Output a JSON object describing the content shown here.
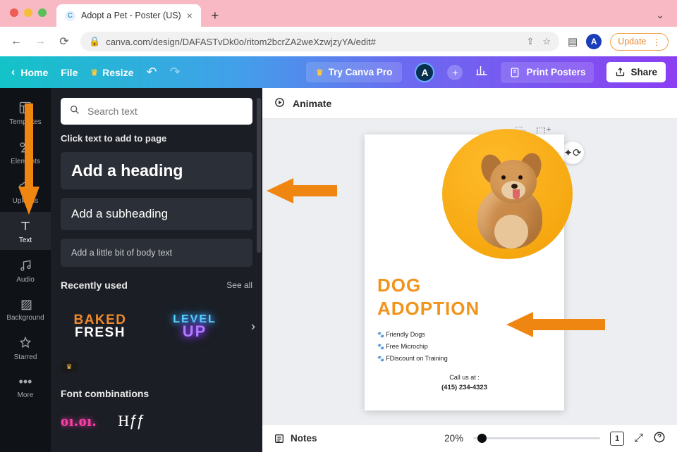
{
  "browser": {
    "tab_title": "Adopt a Pet - Poster (US)",
    "url": "canva.com/design/DAFASTvDk0o/ritom2bcrZA2weXzwjzyYA/edit#",
    "update_label": "Update"
  },
  "appbar": {
    "home": "Home",
    "file": "File",
    "resize": "Resize",
    "try_pro": "Try Canva Pro",
    "print": "Print Posters",
    "share": "Share",
    "avatar_initial": "A"
  },
  "rail": {
    "templates": "Templates",
    "elements": "Elements",
    "uploads": "Uploads",
    "text": "Text",
    "audio": "Audio",
    "background": "Background",
    "starred": "Starred",
    "more": "More"
  },
  "panel": {
    "search_placeholder": "Search text",
    "hint": "Click text to add to page",
    "add_heading": "Add a heading",
    "add_subheading": "Add a subheading",
    "add_body": "Add a little bit of body text",
    "recently_used": "Recently used",
    "see_all": "See all",
    "font_combinations": "Font combinations",
    "thumb_baked_1": "BAKED",
    "thumb_baked_2": "FRESH",
    "thumb_level_1": "LEVEL",
    "thumb_level_2": "UP"
  },
  "context": {
    "animate": "Animate"
  },
  "poster": {
    "title_line1": "DOG",
    "title_line2": "ADOPTION",
    "bullet1": "Friendly Dogs",
    "bullet2": "Free Microchip",
    "bullet3": "FDiscount on Training",
    "call_label": "Call us at :",
    "phone": "(415) 234-4323"
  },
  "bottom": {
    "notes": "Notes",
    "zoom": "20%",
    "page": "1"
  }
}
